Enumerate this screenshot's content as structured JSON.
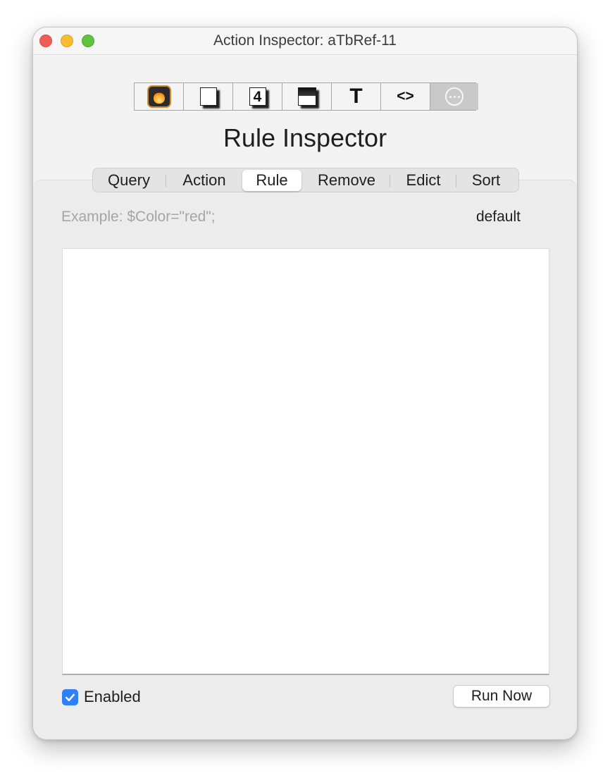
{
  "window": {
    "title": "Action Inspector: aTbRef-11"
  },
  "toolbar": {
    "buttons": [
      {
        "icon": "flame-icon"
      },
      {
        "icon": "page-icon"
      },
      {
        "icon": "badge-icon",
        "glyph": "4"
      },
      {
        "icon": "shade-icon"
      },
      {
        "icon": "text-icon",
        "glyph": "T"
      },
      {
        "icon": "code-icon",
        "glyph": "<>"
      },
      {
        "icon": "more-icon",
        "selected": true
      }
    ]
  },
  "inspector": {
    "heading": "Rule Inspector"
  },
  "tabs": [
    {
      "label": "Query"
    },
    {
      "label": "Action"
    },
    {
      "label": "Rule",
      "selected": true
    },
    {
      "label": "Remove"
    },
    {
      "label": "Edict"
    },
    {
      "label": "Sort"
    }
  ],
  "rule": {
    "example": "Example: $Color=\"red\";",
    "default_label": "default",
    "code": "",
    "enabled": true,
    "enabled_label": "Enabled",
    "run_label": "Run Now"
  },
  "colors": {
    "accent": "#2f7ff6",
    "close": "#ee5e57",
    "minimize": "#f5bd2f",
    "zoom": "#5fc43d"
  }
}
